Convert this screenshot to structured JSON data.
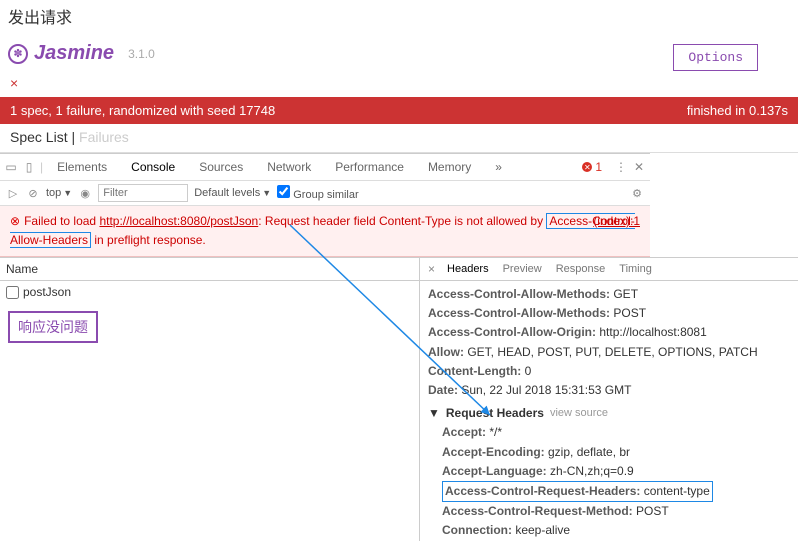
{
  "page_title": "发出请求",
  "jasmine": {
    "name": "Jasmine",
    "version": "3.1.0",
    "options": "Options",
    "fail": "×"
  },
  "status": {
    "left": "1 spec, 1 failure, randomized with seed 17748",
    "right": "finished in 0.137s"
  },
  "spec_tabs": {
    "list": "Spec List",
    "sep": " | ",
    "failures": "Failures"
  },
  "devtools": {
    "tabs": [
      "Elements",
      "Console",
      "Sources",
      "Network",
      "Performance",
      "Memory"
    ],
    "more": "»",
    "error_count": "1",
    "menu": "⋮",
    "filter": {
      "top": "top",
      "placeholder": "Filter",
      "levels": "Default levels",
      "group": "Group similar"
    },
    "error": {
      "x": "⊗",
      "prefix": "Failed to load ",
      "url": "http://localhost:8080/postJson",
      "mid": ": Request header field Content-Type is not allowed by ",
      "highlight": "Access-Control-Allow-Headers",
      "suffix": " in preflight response.",
      "index": "(index):1"
    }
  },
  "network": {
    "name_header": "Name",
    "row": "postJson",
    "chinese": "响应没问题",
    "tabs": {
      "x": "×",
      "headers": "Headers",
      "preview": "Preview",
      "response": "Response",
      "timing": "Timing"
    },
    "response_headers": [
      {
        "k": "Access-Control-Allow-Methods:",
        "v": " GET"
      },
      {
        "k": "Access-Control-Allow-Methods:",
        "v": " POST"
      },
      {
        "k": "Access-Control-Allow-Origin:",
        "v": " http://localhost:8081"
      },
      {
        "k": "Allow:",
        "v": " GET, HEAD, POST, PUT, DELETE, OPTIONS, PATCH"
      },
      {
        "k": "Content-Length:",
        "v": " 0"
      },
      {
        "k": "Date:",
        "v": " Sun, 22 Jul 2018 15:31:53 GMT"
      }
    ],
    "req_section": "Request Headers",
    "view_source": "view source",
    "request_headers": [
      {
        "k": "Accept:",
        "v": " */*"
      },
      {
        "k": "Accept-Encoding:",
        "v": " gzip, deflate, br"
      },
      {
        "k": "Accept-Language:",
        "v": " zh-CN,zh;q=0.9"
      },
      {
        "k": "Access-Control-Request-Headers:",
        "v": " content-type",
        "box": true
      },
      {
        "k": "Access-Control-Request-Method:",
        "v": " POST"
      },
      {
        "k": "Connection:",
        "v": " keep-alive"
      }
    ]
  }
}
